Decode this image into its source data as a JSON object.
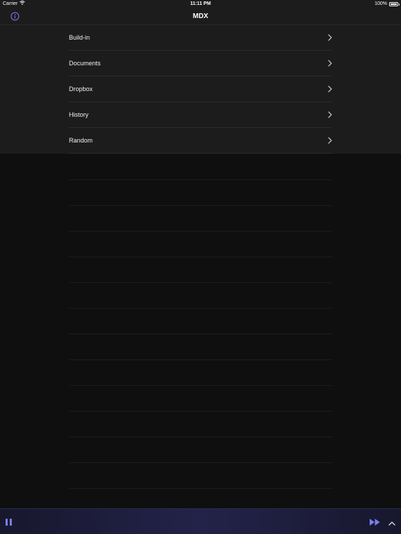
{
  "status_bar": {
    "carrier": "Carrier",
    "time": "11:11 PM",
    "battery_percent": "100%",
    "battery_level": 1.0
  },
  "nav_bar": {
    "title": "MDX",
    "left_icon": "info-icon"
  },
  "menu": {
    "items": [
      {
        "label": "Build-in"
      },
      {
        "label": "Documents"
      },
      {
        "label": "Dropbox"
      },
      {
        "label": "History"
      },
      {
        "label": "Random"
      }
    ],
    "accessory_icon": "chevron-right-icon"
  },
  "player_bar": {
    "left_icon": "pause-icon",
    "right_icons": [
      "fast-forward-icon",
      "chevron-up-icon"
    ],
    "accent_color": "#6f72e8"
  },
  "colors": {
    "background": "#0f0f10",
    "panel": "#1c1c1d",
    "text": "#ffffff",
    "accent": "#6f72e8"
  }
}
